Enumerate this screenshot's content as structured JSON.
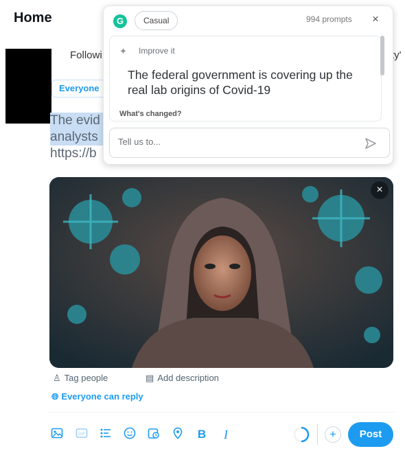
{
  "header": {
    "title": "Home"
  },
  "tabs": {
    "following": "Followi",
    "right_partial": "ty'"
  },
  "audience": {
    "label": "Everyone"
  },
  "draft": {
    "line1": "The evid",
    "line2": "analysts",
    "line3": "https://b"
  },
  "grammarly": {
    "logo": "G",
    "tone": "Casual",
    "prompts_count": "994 prompts",
    "close": "×",
    "improve_label": "Improve it",
    "suggestion": "The federal government is covering up the real lab origins of Covid-19",
    "whats_changed": "What's changed?",
    "input_placeholder": "Tell us to...",
    "icons": {
      "logo": "grammarly-icon",
      "sparkle": "sparkle-icon",
      "send": "send-icon",
      "close": "close-icon"
    }
  },
  "media": {
    "close": "×",
    "description": "Hooded man in a dark hoodie staring at camera with green coronavirus particles around him"
  },
  "media_actions": {
    "tag_people": "Tag people",
    "add_description": "Add description"
  },
  "reply": {
    "label": "Everyone can reply"
  },
  "toolbar": {
    "icons": [
      "image-icon",
      "gif-icon",
      "poll-icon",
      "emoji-icon",
      "schedule-icon",
      "location-icon",
      "bold-icon",
      "italic-icon"
    ],
    "bold": "B",
    "italic": "I",
    "plus": "+",
    "post": "Post"
  },
  "colors": {
    "accent": "#1d9bf0",
    "grammarly": "#15c39a",
    "highlight": "#c9ddf4"
  }
}
